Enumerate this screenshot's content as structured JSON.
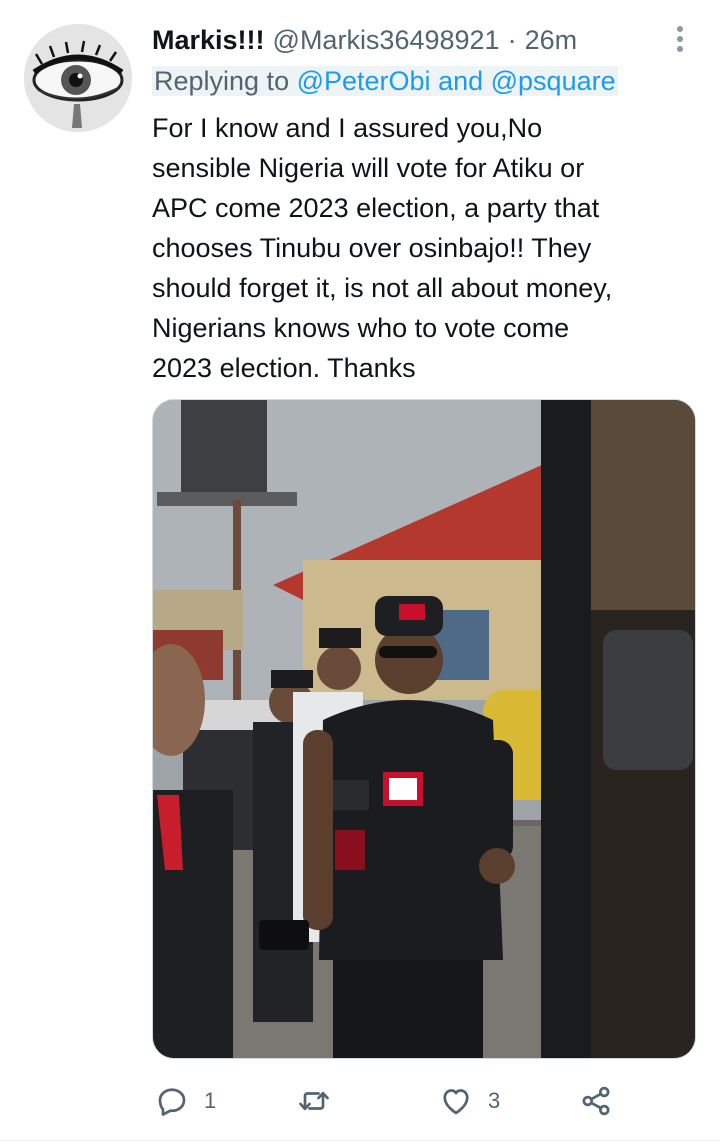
{
  "tweet": {
    "display_name": "Markis!!!",
    "handle": "@Markis36498921",
    "separator": "·",
    "time": "26m",
    "replying_prefix": "Replying to ",
    "mention_1": "@PeterObi",
    "mention_joiner": " and ",
    "mention_2": "@psquare",
    "text": "For I know and I assured you,No\nsensible Nigeria will vote for Atiku or\nAPC come 2023 election, a party that\nchooses Tinubu over osinbajo!!  They\nshould forget it, is not all about money,\nNigerians knows who to vote come\n2023 election. Thanks"
  },
  "actions": {
    "reply_count": "1",
    "retweet_count": "",
    "like_count": "3"
  },
  "icons": {
    "more": "more-vertical-icon",
    "reply": "reply-bubble-icon",
    "retweet": "retweet-icon",
    "like": "heart-icon",
    "share": "share-icon"
  },
  "colors": {
    "text": "#0f1419",
    "secondary": "#536471",
    "link": "#1d9bf0",
    "border": "#cfd9de"
  }
}
